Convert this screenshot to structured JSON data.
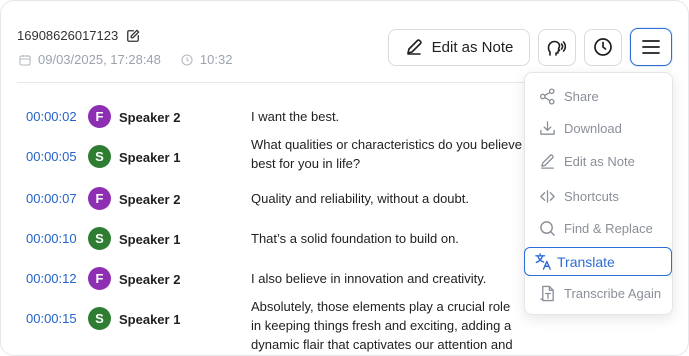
{
  "header": {
    "recording_id": "16908626017123",
    "date": "09/03/2025, 17:28:48",
    "duration": "10:32"
  },
  "toolbar": {
    "edit_note_label": "Edit as Note",
    "edit_icon": "pencil-icon",
    "speaker_icon": "speaker-voice-icon",
    "history_icon": "clock-icon",
    "menu_icon": "hamburger-menu-icon"
  },
  "transcript": [
    {
      "time": "00:00:02",
      "initial": "F",
      "speaker": "Speaker 2",
      "color": "#8e2fb3",
      "text": "I want the best."
    },
    {
      "time": "00:00:05",
      "initial": "S",
      "speaker": "Speaker 1",
      "color": "#2e7d32",
      "text": "What qualities or characteristics do you believe t best for you in life?"
    },
    {
      "time": "00:00:07",
      "initial": "F",
      "speaker": "Speaker 2",
      "color": "#8e2fb3",
      "text": "Quality and reliability, without a doubt."
    },
    {
      "time": "00:00:10",
      "initial": "S",
      "speaker": "Speaker 1",
      "color": "#2e7d32",
      "text": "That’s a solid foundation to build on."
    },
    {
      "time": "00:00:12",
      "initial": "F",
      "speaker": "Speaker 2",
      "color": "#8e2fb3",
      "text": "I also believe in innovation and creativity."
    },
    {
      "time": "00:00:15",
      "initial": "S",
      "speaker": "Speaker 1",
      "color": "#2e7d32",
      "text": "Absolutely, those elements play a crucial role in keeping things fresh and exciting, adding a dynamic flair that captivates our attention and encourages us to explore further."
    }
  ],
  "menu": {
    "items": [
      {
        "label": "Share",
        "icon": "share-icon"
      },
      {
        "label": "Download",
        "icon": "download-icon"
      },
      {
        "label": "Edit as Note",
        "icon": "pencil-icon"
      },
      {
        "label": "Shortcuts",
        "icon": "code-brackets-icon"
      },
      {
        "label": "Find & Replace",
        "icon": "search-icon"
      },
      {
        "label": "Translate",
        "icon": "translate-icon",
        "active": true
      },
      {
        "label": "Transcribe Again",
        "icon": "transcribe-icon"
      }
    ]
  },
  "colors": {
    "accent": "#2e6cd6",
    "timestamp": "#2563c9",
    "speaker_2": "#8e2fb3",
    "speaker_1": "#2e7d32"
  }
}
